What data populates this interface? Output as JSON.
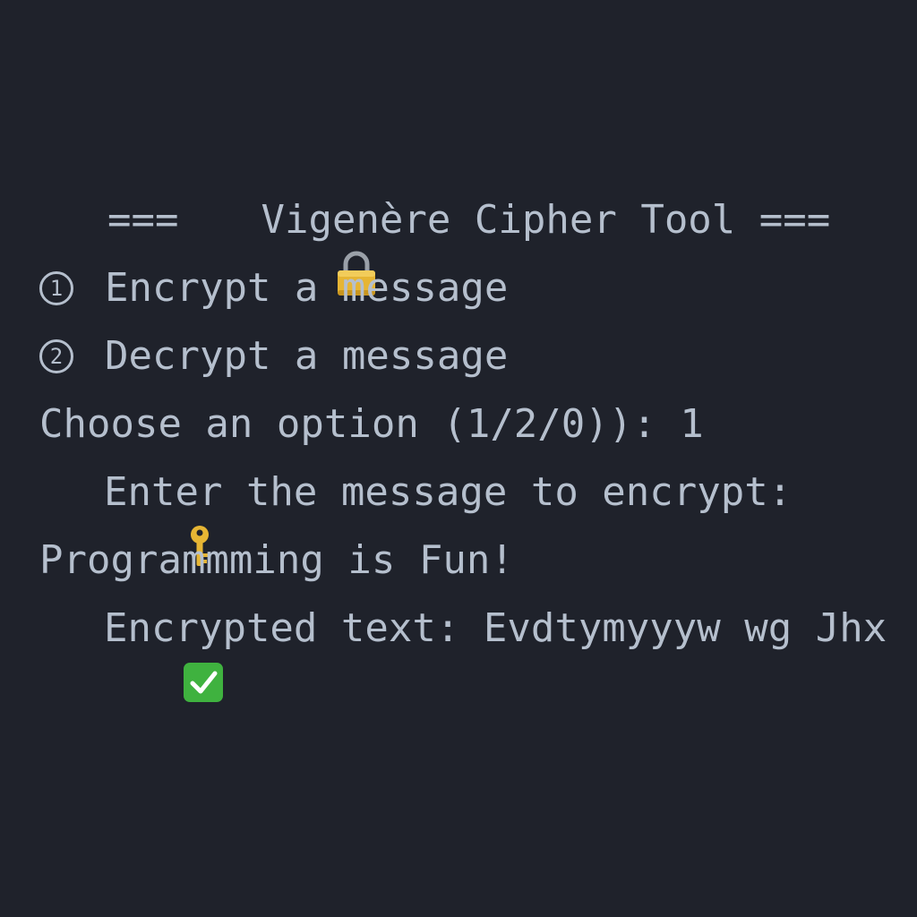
{
  "colors": {
    "background": "#1f222b",
    "text": "#b5bfcd",
    "lock_gold": "#e6b534",
    "check_green": "#3fb23f"
  },
  "icons": [
    "lock-icon",
    "key-icon",
    "check-mark-icon"
  ],
  "terminal": {
    "title_prefix": "===",
    "title": "Vigenère Cipher Tool",
    "title_suffix": "===",
    "menu": [
      {
        "number": "1",
        "label": "Encrypt a message"
      },
      {
        "number": "2",
        "label": "Decrypt a message"
      }
    ],
    "prompt": "Choose an option (1/2/0)): 1",
    "enter_prompt": "Enter the message to encrypt:",
    "user_input": "Programmming is Fun!",
    "result_label": "Encrypted text:",
    "result_value": "Evdtymyyyw wg Jhx"
  }
}
